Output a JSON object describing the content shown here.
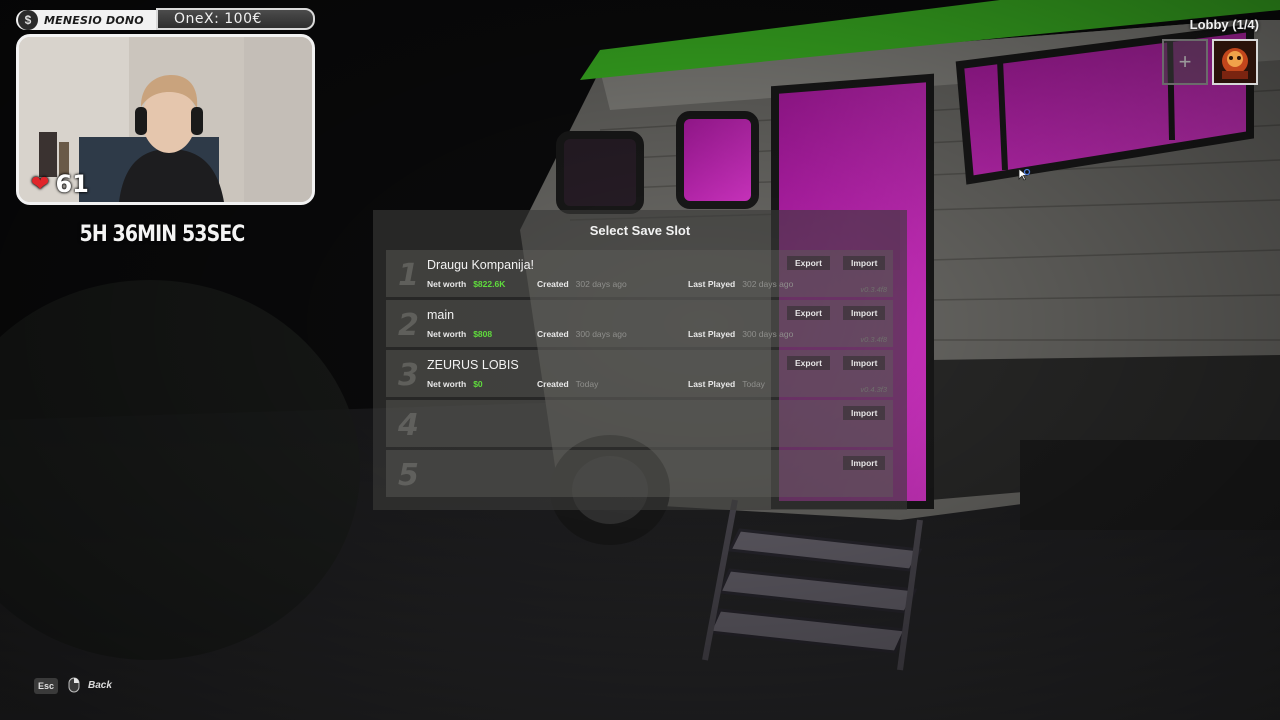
{
  "overlay": {
    "dono_icon": "coin-icon",
    "dono_label": "MENESIO DONO",
    "onex_label": "OneX: 100€",
    "likes_count": "61",
    "timer": "5H 36MIN 53SEC"
  },
  "lobby": {
    "title": "Lobby (1/4)",
    "invite_icon": "+"
  },
  "save_menu": {
    "title": "Select Save Slot",
    "labels": {
      "net_worth": "Net worth",
      "created": "Created",
      "last_played": "Last Played",
      "export": "Export",
      "import": "Import"
    },
    "slots": [
      {
        "number": "1",
        "name": "Draugu Kompanija!",
        "net_worth": "$822.6K",
        "created": "302 days ago",
        "last_played": "302 days ago",
        "version": "v0.3.4f8"
      },
      {
        "number": "2",
        "name": "main",
        "net_worth": "$808",
        "created": "300 days ago",
        "last_played": "300 days ago",
        "version": "v0.3.4f8"
      },
      {
        "number": "3",
        "name": "ZEURUS LOBIS",
        "net_worth": "$0",
        "created": "Today",
        "last_played": "Today",
        "version": "v0.4.3f3"
      },
      {
        "number": "4"
      },
      {
        "number": "5"
      }
    ]
  },
  "footer": {
    "esc_key": "Esc",
    "back_label": "Back"
  },
  "colors": {
    "money_green": "#5fdc3c",
    "neon_pink": "#e01fd0",
    "heart_red": "#e0262b"
  }
}
